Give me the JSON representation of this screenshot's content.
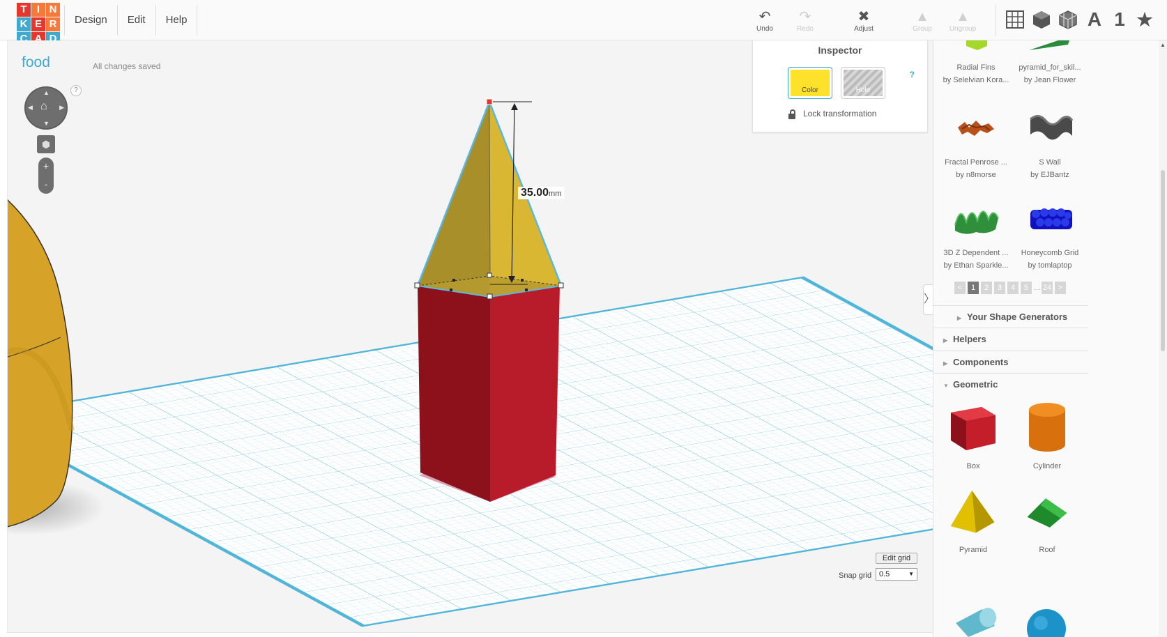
{
  "logo": {
    "letters": [
      "T",
      "I",
      "N",
      "K",
      "E",
      "R",
      "C",
      "A",
      "D"
    ],
    "colors": [
      "#e5372b",
      "#f4793b",
      "#f4793b",
      "#3fa9cf",
      "#e5372b",
      "#f4793b",
      "#3fa9cf",
      "#e5372b",
      "#3fa9cf"
    ]
  },
  "menu": {
    "design": "Design",
    "edit": "Edit",
    "help": "Help"
  },
  "toolbar": {
    "undo": "Undo",
    "redo": "Redo",
    "adjust": "Adjust",
    "group": "Group",
    "ungroup": "Ungroup",
    "view_text": "A",
    "view_num": "1"
  },
  "document": {
    "name": "food",
    "status": "All changes saved"
  },
  "nav": {
    "help": "?",
    "zoom_in": "+",
    "zoom_out": "-"
  },
  "inspector": {
    "title": "Inspector",
    "color_label": "Color",
    "hole_label": "Hole",
    "help": "?",
    "lock_label": "Lock transformation",
    "color_value": "#fde12a"
  },
  "dimension": {
    "value": "35.00",
    "unit": "mm"
  },
  "grid": {
    "edit_label": "Edit grid",
    "snap_label": "Snap grid",
    "snap_value": "0.5"
  },
  "shapes_gallery": [
    {
      "name": "Radial Fins",
      "author": "by Selelvian Kora..."
    },
    {
      "name": "pyramid_for_skil...",
      "author": "by Jean Flower"
    },
    {
      "name": "Fractal Penrose ...",
      "author": "by n8morse"
    },
    {
      "name": "S Wall",
      "author": "by EJBantz"
    },
    {
      "name": "3D Z Dependent ...",
      "author": "by Ethan Sparkle..."
    },
    {
      "name": "Honeycomb Grid",
      "author": "by tomlaptop"
    }
  ],
  "pager": {
    "prev": "<",
    "pages": [
      "1",
      "2",
      "3",
      "4",
      "5"
    ],
    "dots": "...",
    "last": "24",
    "next": ">"
  },
  "sections": {
    "generators": "Your Shape Generators",
    "helpers": "Helpers",
    "components": "Components",
    "geometric": "Geometric"
  },
  "geometric_shapes": [
    {
      "name": "Box"
    },
    {
      "name": "Cylinder"
    },
    {
      "name": "Pyramid"
    },
    {
      "name": "Roof"
    }
  ],
  "colors": {
    "accent": "#3fa9cf",
    "box_red": "#b81c2a",
    "pyramid_yellow": "#d8b630",
    "grid_blue": "#7fcde6"
  }
}
